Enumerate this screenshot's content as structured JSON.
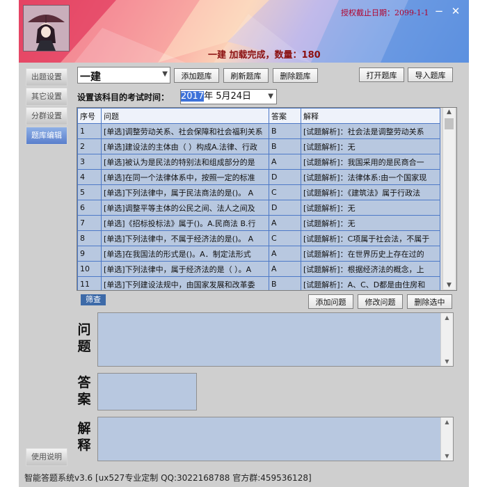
{
  "header": {
    "license": "授权截止日期：",
    "license_date": "2099-1-1",
    "status": "一建 加载完成，数量：180",
    "minimize": "−",
    "close": "✕"
  },
  "sidebar": {
    "items": [
      {
        "label": "出题设置"
      },
      {
        "label": "其它设置"
      },
      {
        "label": "分群设置"
      },
      {
        "label": "题库编辑"
      }
    ],
    "help": "使用说明"
  },
  "toolbar": {
    "subject": "一建",
    "add_bank": "添加题库",
    "refresh_bank": "刷新题库",
    "delete_bank": "删除题库",
    "open_bank": "打开题库",
    "import_bank": "导入题库"
  },
  "exam": {
    "label": "设置该科目的考试时间：",
    "year": "2017",
    "rest": "年  5月24日"
  },
  "table": {
    "headers": [
      "序号",
      "问题",
      "答案",
      "解释"
    ],
    "rows": [
      [
        "1",
        "[单选]调整劳动关系、社会保障和社会福利关系",
        "B",
        "[试题解析]：社会法是调整劳动关系"
      ],
      [
        "2",
        "[单选]建设法的主体由（  ）构成A.法律、行政",
        "B",
        "[试题解析]：无"
      ],
      [
        "3",
        "[单选]被认为是民法的特别法和组成部分的是",
        "A",
        "[试题解析]：我国采用的是民商合一"
      ],
      [
        "4",
        "[单选]在同一个法律体系中，按照一定的标准",
        "D",
        "[试题解析]：法律体系:由一个国家现"
      ],
      [
        "5",
        "[单选]下列法律中，属于民法商法的是()。  A",
        "C",
        "[试题解析]：《建筑法》属于行政法"
      ],
      [
        "6",
        "[单选]调整平等主体的公民之间、法人之间及",
        "D",
        "[试题解析]：无"
      ],
      [
        "7",
        "[单选]《招标投标法》属于()。A.民商法 B.行",
        "A",
        "[试题解析]：无"
      ],
      [
        "8",
        "[单选]下列法律中，不属于经济法的是()。 A",
        "C",
        "[试题解析]：C项属于社会法，不属于"
      ],
      [
        "9",
        "[单选]在我国法的形式是()。A．制定法形式",
        "A",
        "[试题解析]：在世界历史上存在过的"
      ],
      [
        "10",
        "[单选]下列法律中，属于经济法的是（  ）。A",
        "A",
        "[试题解析]：根据经济法的概念，上"
      ],
      [
        "11",
        "[单选]下列建设法规中，由国家发展和改革委",
        "B",
        "[试题解析]：A、C、D都是由住房和"
      ]
    ]
  },
  "filter": "筛查",
  "actions": {
    "add_question": "添加问题",
    "edit_question": "修改问题",
    "delete_selected": "删除选中"
  },
  "labels": {
    "question": "问题",
    "answer": "答案",
    "explanation": "解释"
  },
  "footer": "智能答题系统v3.6 [ux527专业定制 QQ:3022168788 官方群:459536128]"
}
